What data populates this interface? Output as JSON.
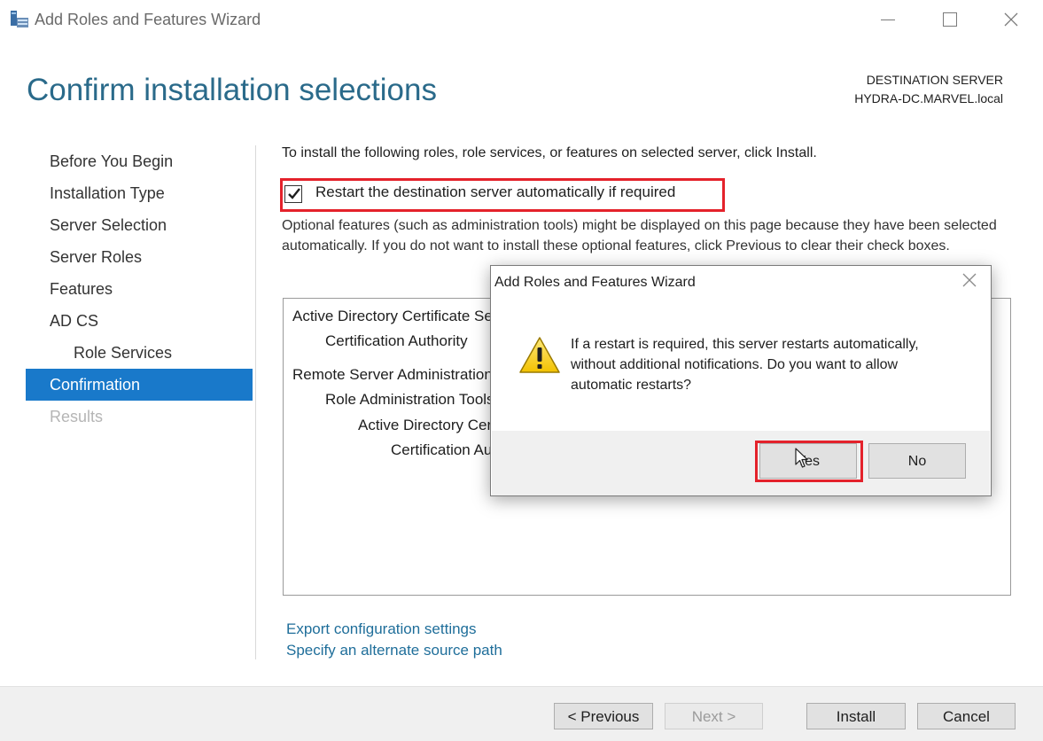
{
  "window": {
    "title": "Add Roles and Features Wizard",
    "icon": "server-manager-icon",
    "controls": {
      "minimize_icon": "minimize-icon",
      "maximize_icon": "maximize-icon",
      "close_icon": "close-icon"
    }
  },
  "header": {
    "page_title": "Confirm installation selections",
    "destination_label": "DESTINATION SERVER",
    "destination_value": "HYDRA-DC.MARVEL.local"
  },
  "nav": {
    "items": [
      {
        "label": "Before You Begin",
        "state": "normal"
      },
      {
        "label": "Installation Type",
        "state": "normal"
      },
      {
        "label": "Server Selection",
        "state": "normal"
      },
      {
        "label": "Server Roles",
        "state": "normal"
      },
      {
        "label": "Features",
        "state": "normal"
      },
      {
        "label": "AD CS",
        "state": "normal"
      },
      {
        "label": "Role Services",
        "state": "sub"
      },
      {
        "label": "Confirmation",
        "state": "active"
      },
      {
        "label": "Results",
        "state": "disabled"
      }
    ]
  },
  "main": {
    "intro": "To install the following roles, role services, or features on selected server, click Install.",
    "restart_checkbox": {
      "label": "Restart the destination server automatically if required",
      "checked": true
    },
    "optional_note": "Optional features (such as administration tools) might be displayed on this page because they have been selected automatically. If you do not want to install these optional features, click Previous to clear their check boxes.",
    "selections": [
      "Active Directory Certificate Services",
      "Certification Authority",
      "Remote Server Administration Tools",
      "Role Administration Tools",
      "Active Directory Certificate Services Tools",
      "Certification Authority Management Tools"
    ],
    "links": {
      "export": "Export configuration settings",
      "alternate_source": "Specify an alternate source path"
    }
  },
  "footer": {
    "previous": "< Previous",
    "next": "Next >",
    "install": "Install",
    "cancel": "Cancel"
  },
  "dialog": {
    "title": "Add Roles and Features Wizard",
    "icon": "warning-icon",
    "message": "If a restart is required, this server restarts automatically, without additional notifications. Do you want to allow automatic restarts?",
    "yes_label": "Yes",
    "no_label": "No"
  },
  "colors": {
    "accent": "#1979ca",
    "title": "#2a6a8a",
    "link": "#1f6e9a",
    "highlight": "#e4222b"
  }
}
